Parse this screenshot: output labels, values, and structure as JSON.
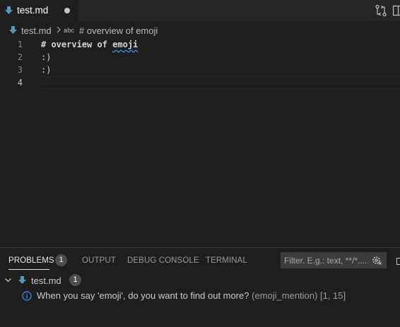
{
  "tab": {
    "title": "test.md"
  },
  "breadcrumb": {
    "file": "test.md",
    "symbol_kind": "abc",
    "heading": "# overview of emoji"
  },
  "editor": {
    "lines": [
      {
        "number": "1",
        "code": "# overview of ",
        "squiggle_word": "emoji"
      },
      {
        "number": "2",
        "code": ":)"
      },
      {
        "number": "3",
        "code": ":)"
      },
      {
        "number": "4",
        "code": ""
      }
    ]
  },
  "panel": {
    "tabs": {
      "problems": "PROBLEMS",
      "output": "OUTPUT",
      "debug_console": "DEBUG CONSOLE",
      "terminal": "TERMINAL"
    },
    "problems_count": "1",
    "filter_placeholder": "Filter. E.g.: text, **/*....",
    "file": {
      "name": "test.md",
      "count": "1"
    },
    "problem": {
      "message": "When you say 'emoji', do you want to find out more?",
      "source": "(emoji_mention)",
      "position": "[1, 15]"
    }
  },
  "colors": {
    "markdown_icon": "#519aba",
    "heading": "#569cd6",
    "info": "#3794ff",
    "squiggle": "#3794ff"
  }
}
